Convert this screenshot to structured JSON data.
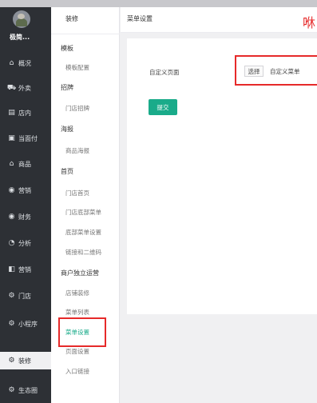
{
  "app": {
    "shop_name": "极简...",
    "nav": [
      {
        "label": "概况",
        "icon": "home-icon"
      },
      {
        "label": "外卖",
        "icon": "delivery-icon"
      },
      {
        "label": "店内",
        "icon": "store-icon"
      },
      {
        "label": "当面付",
        "icon": "pay-icon"
      },
      {
        "label": "商品",
        "icon": "shop-icon"
      },
      {
        "label": "营销",
        "icon": "marketing-icon"
      },
      {
        "label": "财务",
        "icon": "finance-icon"
      },
      {
        "label": "分析",
        "icon": "chart-icon"
      },
      {
        "label": "营销",
        "icon": "promo-icon"
      },
      {
        "label": "门店",
        "icon": "location-icon"
      },
      {
        "label": "小程序",
        "icon": "miniprogram-icon"
      },
      {
        "label": "装修",
        "icon": "decorate-icon"
      },
      {
        "label": "生态圈",
        "icon": "ecosystem-icon"
      }
    ]
  },
  "submenu": {
    "title": "装修",
    "groups": [
      {
        "title": "模板",
        "items": [
          "模板配置"
        ]
      },
      {
        "title": "招牌",
        "items": [
          "门店招牌"
        ]
      },
      {
        "title": "海报",
        "items": [
          "商品海报"
        ]
      },
      {
        "title": "首页",
        "items": [
          "门店首页",
          "门店底部菜单",
          "底部菜单设置",
          "链接和二维码"
        ]
      },
      {
        "title": "商户独立运营",
        "items": [
          "店铺装修",
          "菜单列表",
          "菜单设置",
          "页面设置",
          "入口链接"
        ]
      }
    ],
    "selected_item": "菜单设置"
  },
  "header": {
    "title": "菜单设置",
    "note": "咻"
  },
  "form": {
    "label": "自定义页面",
    "select_button": "选择",
    "select_value": "自定义菜单",
    "submit_label": "提交"
  },
  "colors": {
    "sidebar_bg": "#2d3035",
    "accent": "#1aab8a",
    "highlight": "#e62a2a"
  }
}
